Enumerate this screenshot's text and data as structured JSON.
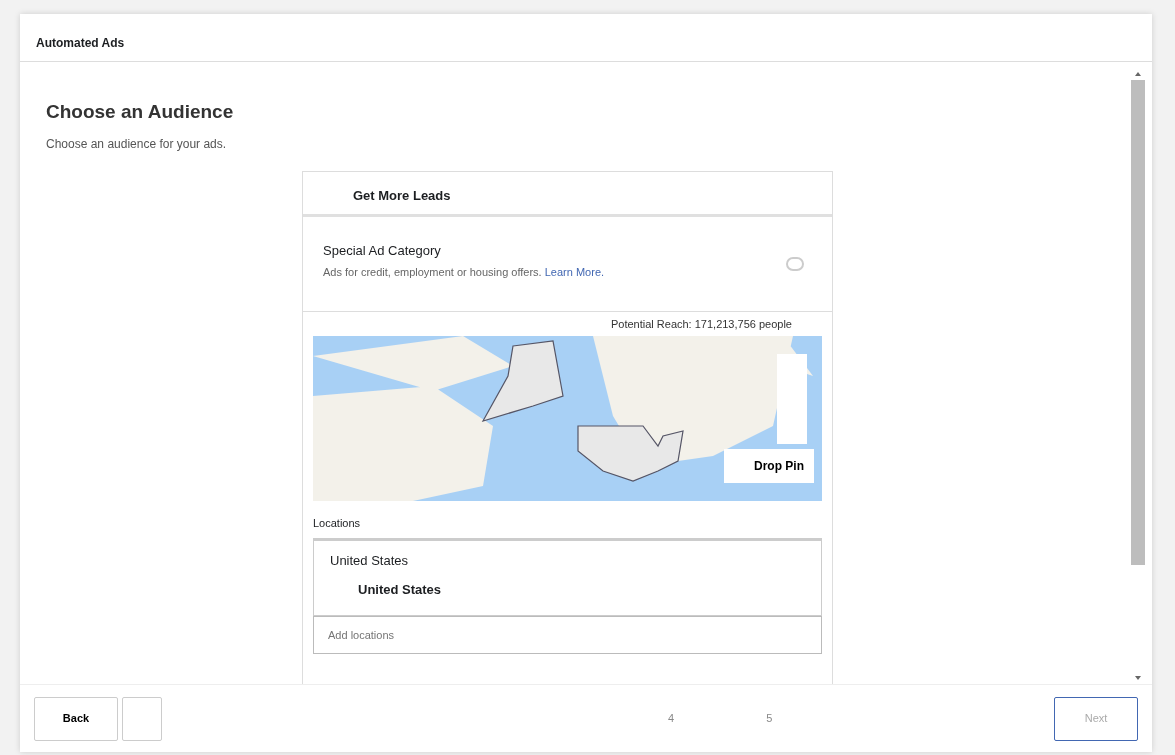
{
  "window": {
    "title": "Automated Ads"
  },
  "page": {
    "heading": "Choose an Audience",
    "subtitle": "Choose an audience for your ads."
  },
  "goal": {
    "title": "Get More Leads"
  },
  "special_ad_category": {
    "title": "Special Ad Category",
    "description": "Ads for credit, employment or housing offers.",
    "link": "Learn More.",
    "on": false
  },
  "potential_reach": "Potential Reach: 171,213,756 people",
  "map": {
    "drop_pin": "Drop Pin"
  },
  "locations": {
    "label": "Locations",
    "items": [
      {
        "name": "United States",
        "children": [
          {
            "name": "United States"
          }
        ]
      }
    ],
    "placeholder": "Add locations"
  },
  "footer": {
    "back": "Back",
    "pages": [
      {
        "label": "4",
        "selected": false
      },
      {
        "label": "5",
        "selected": false
      }
    ],
    "next": "Next",
    "next_disabled": true
  }
}
